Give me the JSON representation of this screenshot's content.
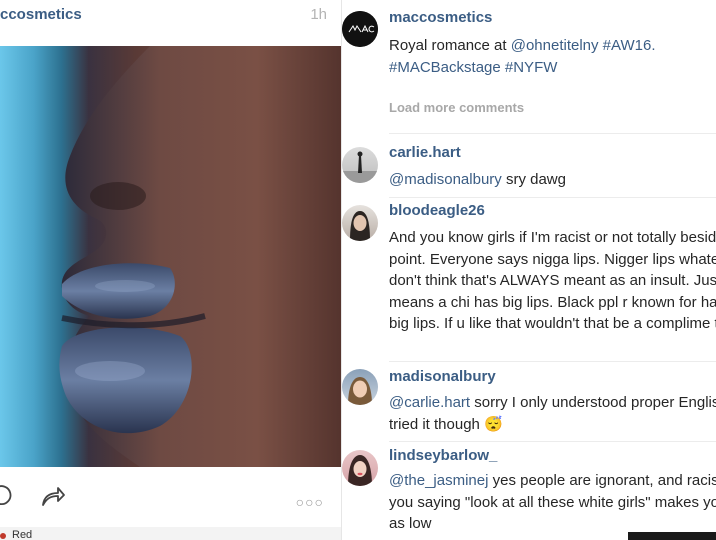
{
  "post": {
    "username": "ccosmetics",
    "time": "1h",
    "more": "○○○",
    "bottom_label": "Red"
  },
  "caption": {
    "username": "maccosmetics",
    "text_prefix": "Royal romance at ",
    "mention": "@ohnetitelny",
    "text_suffix": " #AW16.",
    "line2": "#MACBackstage #NYFW"
  },
  "load_more": "Load more comments",
  "comments": [
    {
      "username": "carlie.hart",
      "mention": "@madisonalbury",
      "text": " sry dawg"
    },
    {
      "username": "bloodeagle26",
      "mention": "",
      "text": "And you know girls if I'm racist or not totally besides the point. Everyone says nigga lips. Nigger lips whatever. I don't think that's ALWAYS meant as an insult. Just means a chi has big lips. Black ppl r known for having big lips. If u like that wouldn't that be a complime to u?"
    },
    {
      "username": "madisonalbury",
      "mention": "@carlie.hart",
      "text": " sorry I only understood proper English. You tried it though 😴"
    },
    {
      "username": "lindseybarlow_",
      "mention": "@the_jasminej",
      "text": " yes people are ignorant, and racist, but you saying \"look at all these white girls\" makes you just as low"
    }
  ],
  "colors": {
    "link": "#3b5d84",
    "muted": "#a8a8a8"
  },
  "icons": [
    "comment-icon",
    "share-icon",
    "more-icon"
  ]
}
